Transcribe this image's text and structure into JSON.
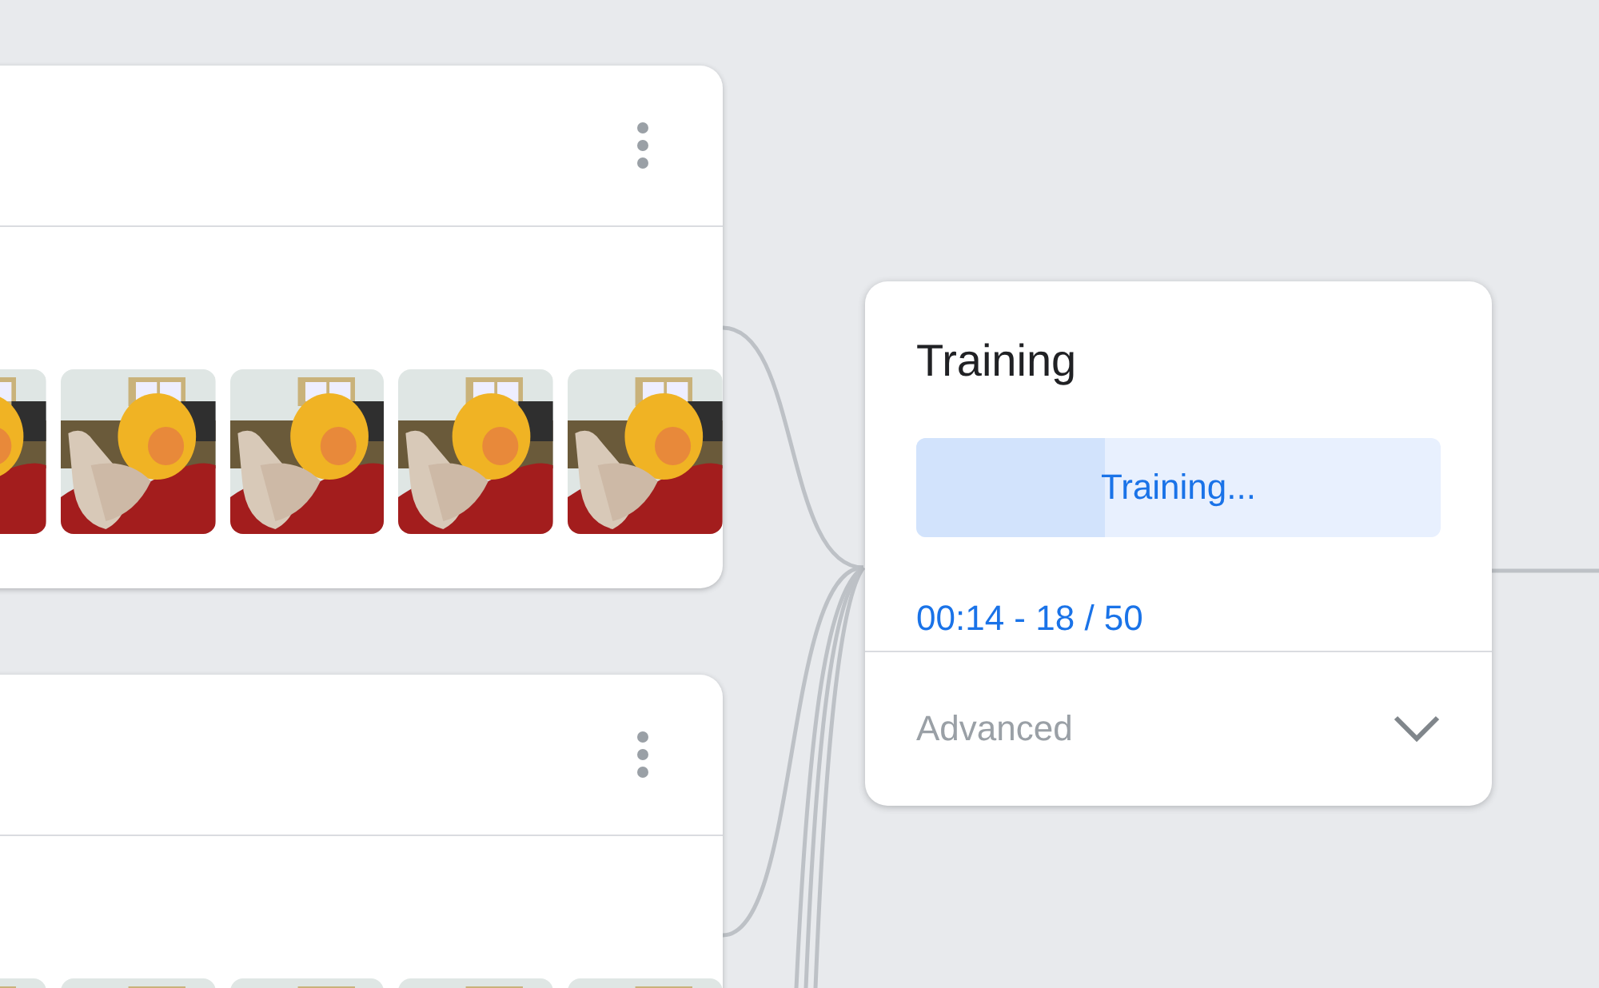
{
  "training": {
    "title": "Training",
    "button": {
      "label": "Training...",
      "level": 0.36
    },
    "status": "00:14 - 18 / 50",
    "advanced": {
      "label": "Advanced",
      "expanded": false
    }
  }
}
